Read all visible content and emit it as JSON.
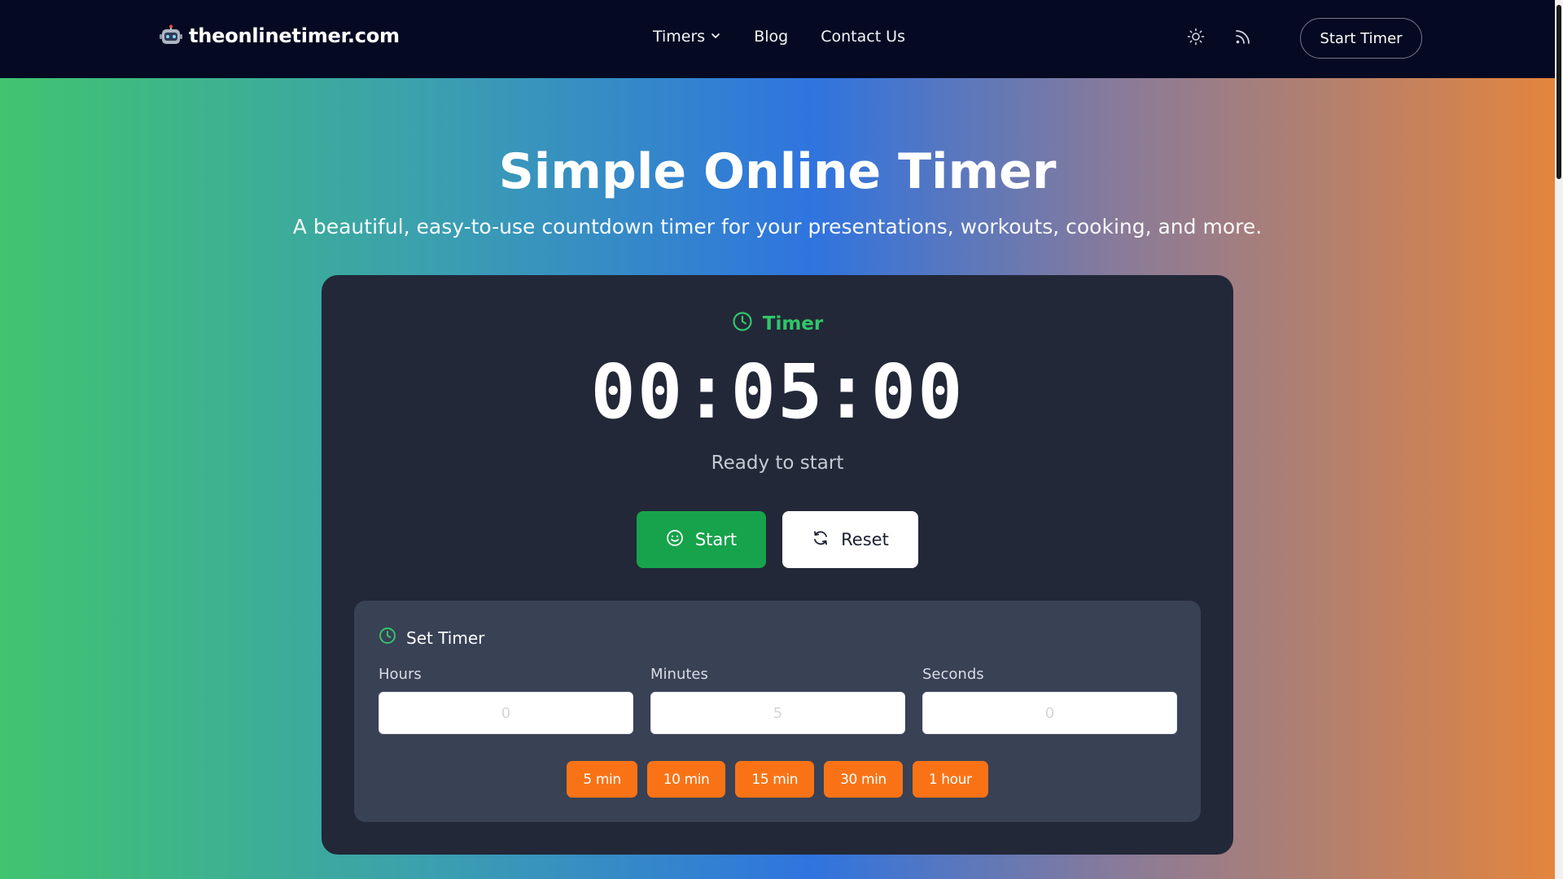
{
  "nav": {
    "logo_text": "theonlinetimer.com",
    "logo_icon": "robot-icon",
    "links": [
      {
        "label": "Timers",
        "has_dropdown": true
      },
      {
        "label": "Blog"
      },
      {
        "label": "Contact Us"
      }
    ],
    "theme_icon": "sun-icon",
    "rss_icon": "rss-icon",
    "cta_label": "Start Timer"
  },
  "hero": {
    "title": "Simple Online Timer",
    "subtitle": "A beautiful, easy-to-use countdown timer for your presentations, workouts, cooking, and more."
  },
  "timer": {
    "label": "Timer",
    "display": "00:05:00",
    "status": "Ready to start",
    "start_label": "Start",
    "reset_label": "Reset"
  },
  "set_timer": {
    "title": "Set Timer",
    "hours_label": "Hours",
    "hours_placeholder": "0",
    "minutes_label": "Minutes",
    "minutes_placeholder": "5",
    "seconds_label": "Seconds",
    "seconds_placeholder": "0",
    "presets": [
      "5 min",
      "10 min",
      "15 min",
      "30 min",
      "1 hour"
    ]
  },
  "colors": {
    "nav_bg": "#050a22",
    "card_bg": "#222838",
    "panel_bg": "#394155",
    "accent_green": "#17a34b",
    "label_green": "#32c56a",
    "preset_orange": "#f97316"
  }
}
